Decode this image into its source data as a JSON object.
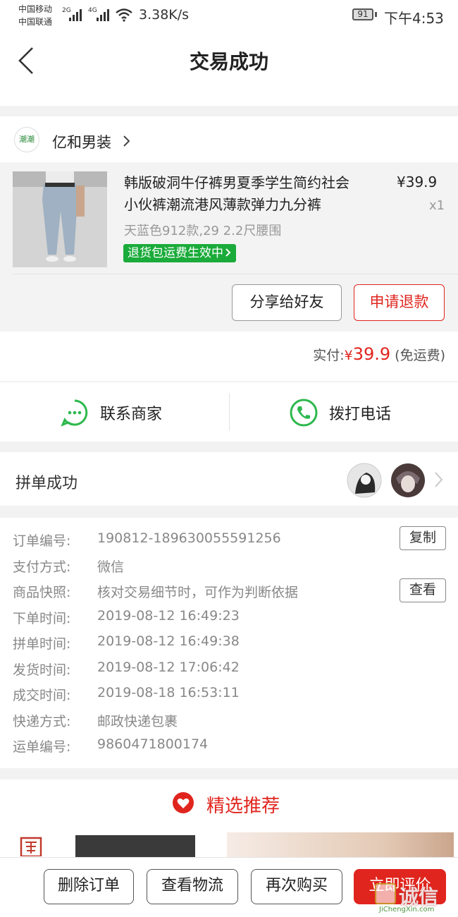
{
  "status_bar": {
    "carrier_1": "中国移动",
    "carrier_2": "中国联通",
    "net_1": "2G",
    "net_2": "4G",
    "speed": "3.38K/s",
    "battery": "91",
    "time": "下午4:53"
  },
  "header": {
    "title": "交易成功"
  },
  "shop": {
    "logo_text": "潮潮",
    "name": "亿和男装"
  },
  "product": {
    "title_line1": "韩版破洞牛仔裤男夏季学生简约社会",
    "title_line2": "小伙裤潮流港风薄款弹力九分裤",
    "price": "¥39.9",
    "quantity": "x1",
    "spec": "天蓝色912款,29 2.2尺腰围",
    "badge": "退货包运费生效中"
  },
  "actions": {
    "share": "分享给好友",
    "refund": "申请退款"
  },
  "payment": {
    "label": "实付:",
    "currency": "¥",
    "amount": "39.9",
    "note": "(免运费)"
  },
  "contact": {
    "merchant": "联系商家",
    "phone": "拨打电话"
  },
  "group": {
    "label": "拼单成功"
  },
  "order_info": {
    "rows": [
      {
        "label": "订单编号:",
        "value": "190812-189630055591256"
      },
      {
        "label": "支付方式:",
        "value": "微信"
      },
      {
        "label": "商品快照:",
        "value": "核对交易细节时，可作为判断依据"
      },
      {
        "label": "下单时间:",
        "value": "2019-08-12 16:49:23"
      },
      {
        "label": "拼单时间:",
        "value": "2019-08-12 16:49:38"
      },
      {
        "label": "发货时间:",
        "value": "2019-08-12 17:06:42"
      },
      {
        "label": "成交时间:",
        "value": "2019-08-18 16:53:11"
      },
      {
        "label": "快递方式:",
        "value": "邮政快递包裹"
      },
      {
        "label": "运单编号:",
        "value": "9860471800174"
      }
    ],
    "copy_label": "复制",
    "view_label": "查看"
  },
  "recommend": {
    "title": "精选推荐"
  },
  "bottom_bar": {
    "delete": "删除订单",
    "logistics": "查看物流",
    "rebuy": "再次购买",
    "review": "立即评价"
  },
  "watermark": {
    "text": "诚信",
    "url": "JiChengXin.com"
  },
  "colors": {
    "accent": "#e0251e",
    "green": "#2db84d",
    "badge_green": "#1aab3a"
  },
  "icons": [
    "back-arrow-icon",
    "chevron-right-icon",
    "chat-bubble-icon",
    "phone-icon",
    "heart-icon"
  ]
}
